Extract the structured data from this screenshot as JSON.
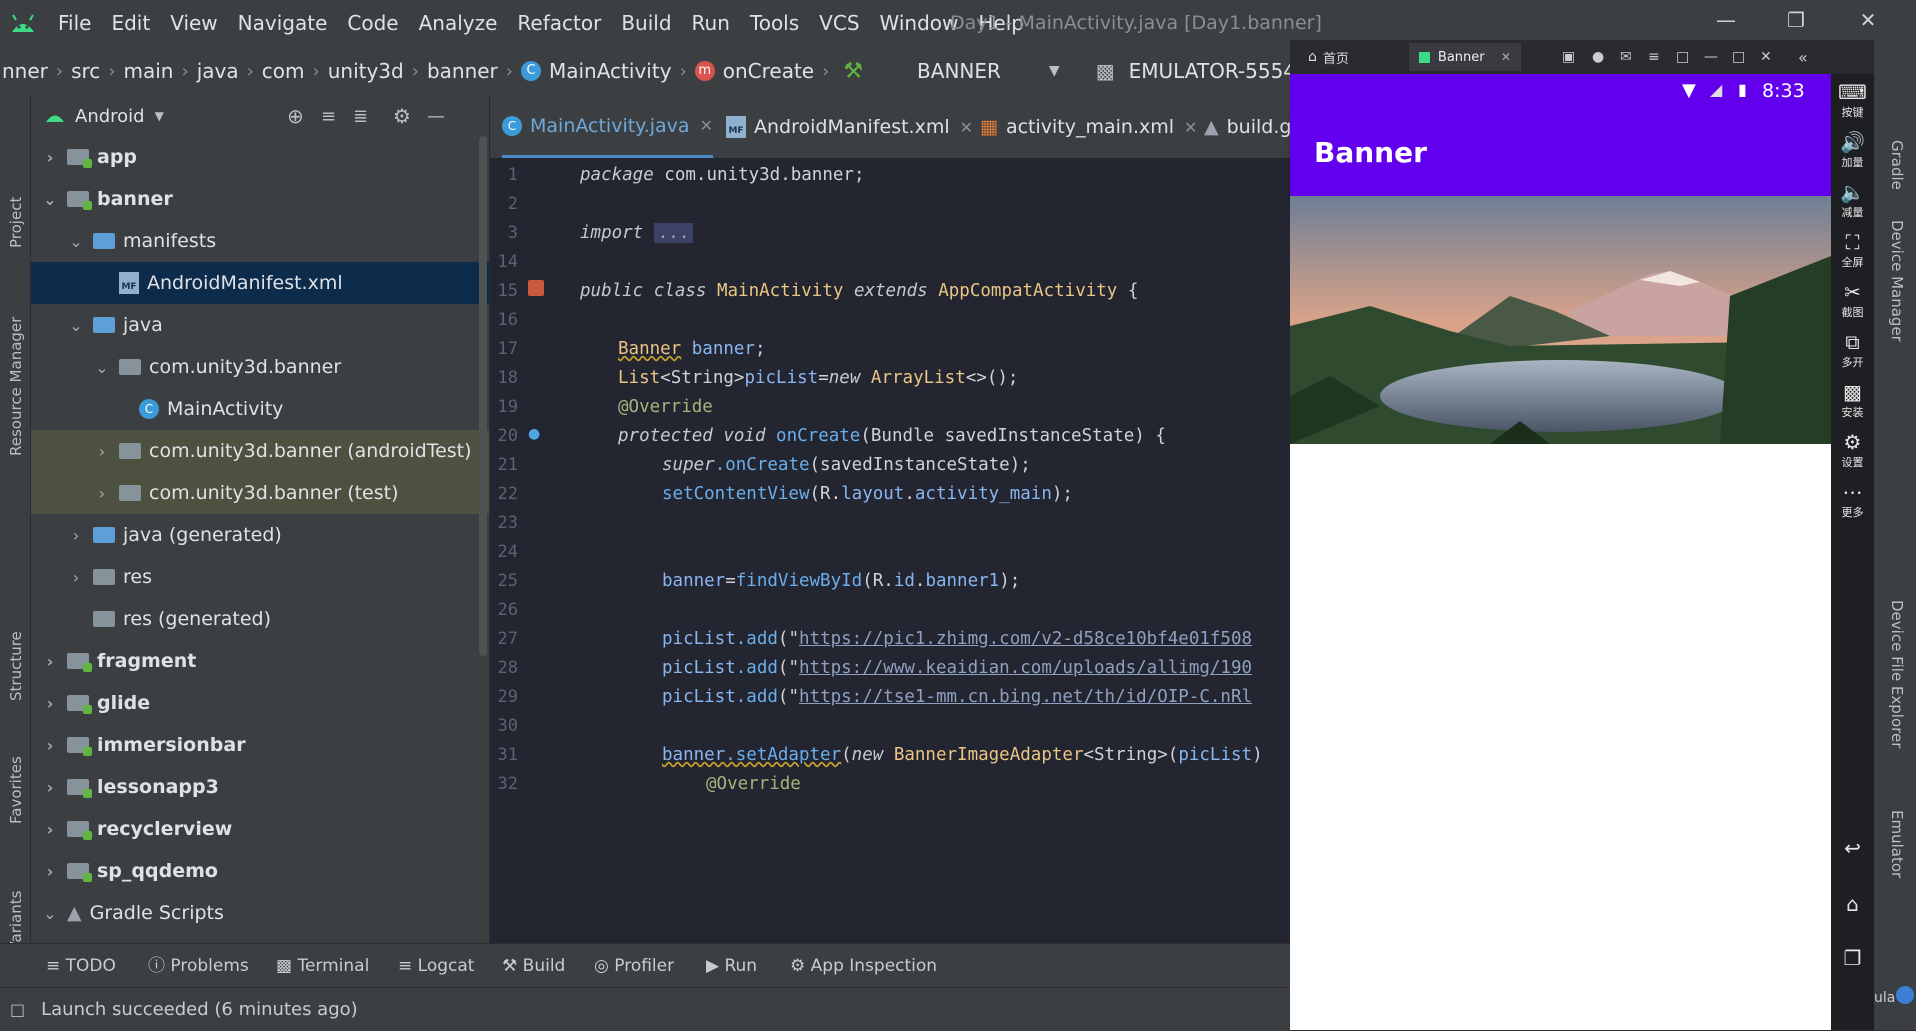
{
  "menubar": {
    "items": [
      "File",
      "Edit",
      "View",
      "Navigate",
      "Code",
      "Analyze",
      "Refactor",
      "Build",
      "Run",
      "Tools",
      "VCS",
      "Window",
      "Help"
    ],
    "window_title": "Day1 - MainActivity.java [Day1.banner]"
  },
  "navbar": {
    "crumbs": [
      "nner",
      "src",
      "main",
      "java",
      "com",
      "unity3d",
      "banner",
      "MainActivity",
      "onCreate"
    ],
    "run_config": "BANNER",
    "device": "EMULATOR-5554"
  },
  "left_strip": {
    "labels": [
      "Project",
      "Resource Manager",
      "Structure",
      "Favorites",
      "Build Variants"
    ]
  },
  "project": {
    "view_mode": "Android",
    "tree": [
      {
        "label": "app",
        "level": 0,
        "expanded": false,
        "bold": true,
        "icon": "module"
      },
      {
        "label": "banner",
        "level": 0,
        "expanded": true,
        "bold": true,
        "icon": "module"
      },
      {
        "label": "manifests",
        "level": 1,
        "expanded": true,
        "bold": false,
        "icon": "folder-blue"
      },
      {
        "label": "AndroidManifest.xml",
        "level": 2,
        "expanded": null,
        "bold": false,
        "icon": "manifest"
      },
      {
        "label": "java",
        "level": 1,
        "expanded": true,
        "bold": false,
        "icon": "folder-blue"
      },
      {
        "label": "com.unity3d.banner",
        "level": 2,
        "expanded": true,
        "bold": false,
        "icon": "package"
      },
      {
        "label": "MainActivity",
        "level": 3,
        "expanded": null,
        "bold": false,
        "icon": "class"
      },
      {
        "label": "com.unity3d.banner (androidTest)",
        "level": 2,
        "expanded": false,
        "bold": false,
        "icon": "package"
      },
      {
        "label": "com.unity3d.banner (test)",
        "level": 2,
        "expanded": false,
        "bold": false,
        "icon": "package"
      },
      {
        "label": "java (generated)",
        "level": 1,
        "expanded": false,
        "bold": false,
        "icon": "folder-gen"
      },
      {
        "label": "res",
        "level": 1,
        "expanded": false,
        "bold": false,
        "icon": "folder"
      },
      {
        "label": "res (generated)",
        "level": 1,
        "expanded": null,
        "bold": false,
        "icon": "folder"
      },
      {
        "label": "fragment",
        "level": 0,
        "expanded": false,
        "bold": true,
        "icon": "module"
      },
      {
        "label": "glide",
        "level": 0,
        "expanded": false,
        "bold": true,
        "icon": "module"
      },
      {
        "label": "immersionbar",
        "level": 0,
        "expanded": false,
        "bold": true,
        "icon": "module"
      },
      {
        "label": "lessonapp3",
        "level": 0,
        "expanded": false,
        "bold": true,
        "icon": "module"
      },
      {
        "label": "recyclerview",
        "level": 0,
        "expanded": false,
        "bold": true,
        "icon": "module"
      },
      {
        "label": "sp_qqdemo",
        "level": 0,
        "expanded": false,
        "bold": true,
        "icon": "module"
      },
      {
        "label": "Gradle Scripts",
        "level": 0,
        "expanded": true,
        "bold": false,
        "icon": "gradle"
      }
    ]
  },
  "editor": {
    "tabs": [
      {
        "label": "MainActivity.java",
        "active": true,
        "closable": true
      },
      {
        "label": "AndroidManifest.xml",
        "active": false,
        "closable": true
      },
      {
        "label": "activity_main.xml",
        "active": false,
        "closable": true
      },
      {
        "label": "build.g",
        "active": false,
        "closable": false
      }
    ],
    "line_numbers": [
      "1",
      "2",
      "3",
      "14",
      "15",
      "16",
      "17",
      "18",
      "19",
      "20",
      "21",
      "22",
      "23",
      "24",
      "25",
      "26",
      "27",
      "28",
      "29",
      "30",
      "31",
      "32"
    ],
    "code": {
      "l1_kw": "package",
      "l1_rest": " com.unity3d.banner;",
      "l3_kw": "import",
      "l3_fold": "...",
      "l15_a": "public class ",
      "l15_cls": "MainActivity",
      "l15_b": " extends ",
      "l15_c": "AppCompatActivity",
      "l15_d": " {",
      "l17_cls": "Banner",
      "l17_field": " banner",
      ";": ";",
      "l18_a": "List",
      "l18_b": "<String>",
      "l18_field": "picList",
      "l18_c": "=",
      "l18_new": "new ",
      "l18_d": "ArrayList",
      "l18_e": "<>();",
      "l19": "@Override",
      "l20_a": "protected void ",
      "l20_fn": "onCreate",
      "l20_b": "(Bundle savedInstanceState) {",
      "l21_kw": "super",
      "l21_fn": ".onCreate",
      "l21_b": "(savedInstanceState);",
      "l22_fn": "setContentView",
      "l22_a": "(R.",
      "l22_f1": "layout",
      "l22_b": ".",
      "l22_f2": "activity_main",
      "l22_c": ");",
      "l25_field": "banner",
      "l25_a": "=",
      "l25_fn": "findViewById",
      "l25_b": "(R.",
      "l25_f1": "id",
      "l25_c": ".",
      "l25_f2": "banner1",
      "l25_d": ");",
      "l27_field": "picList",
      "l27_fn": ".add",
      "l27_a": "(\"",
      "l27_url": "https://pic1.zhimg.com/v2-d58ce10bf4e01f508",
      "l28_field": "picList",
      "l28_fn": ".add",
      "l28_a": "(\"",
      "l28_url": "https://www.keaidian.com/uploads/allimg/190",
      "l29_field": "picList",
      "l29_fn": ".add",
      "l29_a": "(\"",
      "l29_url": "https://tse1-mm.cn.bing.net/th/id/OIP-C.nRl",
      "l31_field": "banner",
      "l31_fn": ".setAdapter",
      "l31_a": "(",
      "l31_new": "new ",
      "l31_cls": "BannerImageAdapter",
      "l31_b": "<String>(",
      "l31_field2": "picList",
      "l31_c": ")",
      "l32": "@Override"
    }
  },
  "emulator": {
    "tabs": [
      {
        "label": "首页"
      },
      {
        "label": "Banner"
      }
    ],
    "status_time": "8:33",
    "app_title": "Banner",
    "side_buttons": [
      "按键",
      "加量",
      "减量",
      "全屏",
      "截图",
      "多开",
      "安装",
      "设置",
      "更多"
    ],
    "right_strip": [
      "Gradle",
      "Device Manager",
      "Device File Explorer",
      "Emulator"
    ],
    "partial_text": "ula"
  },
  "bottombar": {
    "tools": [
      "TODO",
      "Problems",
      "Terminal",
      "Logcat",
      "Build",
      "Profiler",
      "Run",
      "App Inspection"
    ]
  },
  "status": {
    "message": "Launch succeeded (6 minutes ago)"
  },
  "colors": {
    "ide_bg": "#3c3f41",
    "editor_bg": "#232530",
    "app_purple": "#6200ee",
    "selection": "#0d2b4a"
  }
}
